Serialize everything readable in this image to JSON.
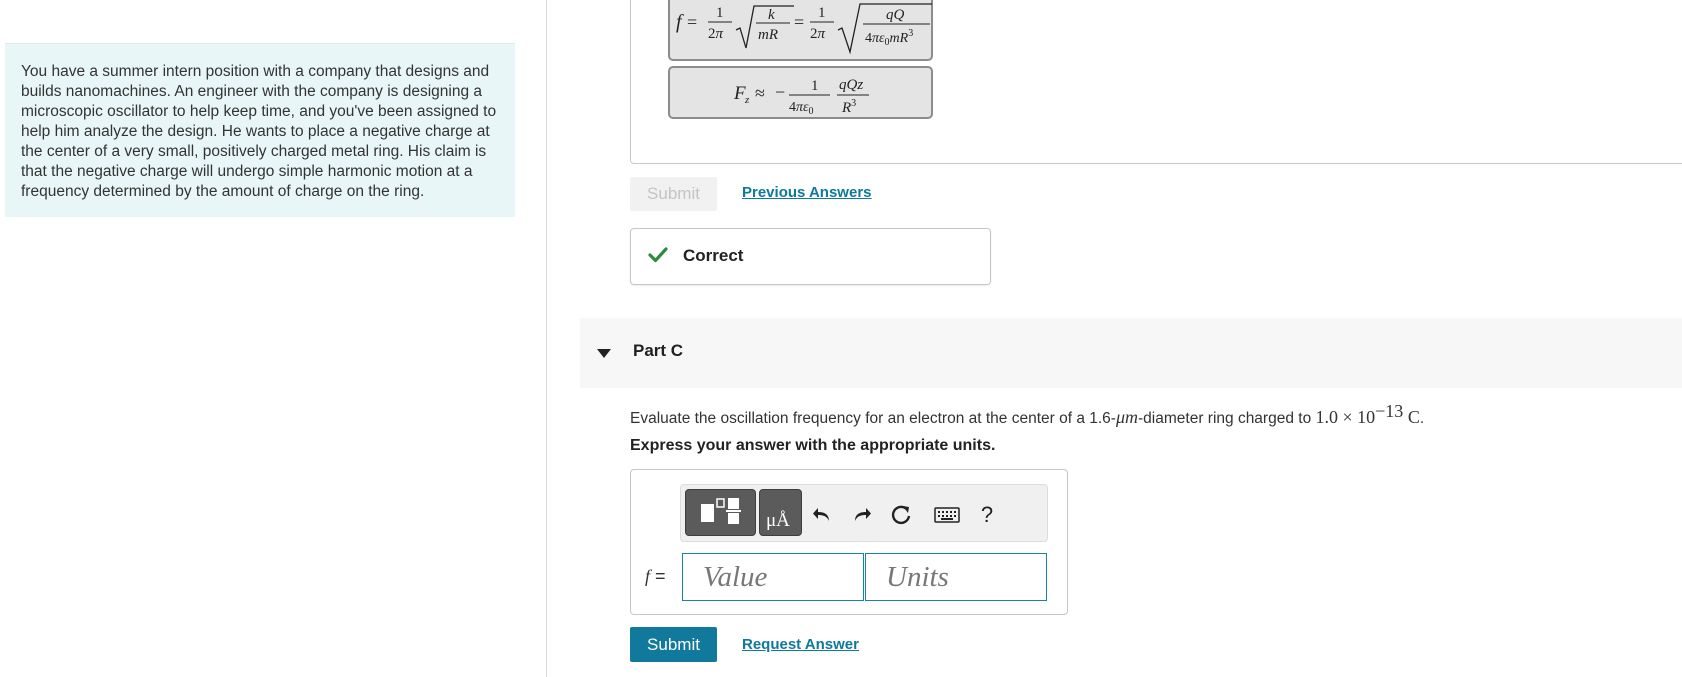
{
  "intro": {
    "text": "You have a summer intern position with a company that designs and builds nanomachines. An engineer with the company is designing a microscopic oscillator to help keep time, and you've been assigned to help him analyze the design. He wants to place a negative charge at the center of a very small, positively charged metal ring. His claim is that the negative charge will undergo simple harmonic motion at a frequency determined by the amount of charge on the ring."
  },
  "previous_answer": {
    "eq1": "f = 1/2π √(k/mR) = 1/2π √(qQ/4πε0mR³)",
    "eq2": "Fz ≈ −1/4πε0 · qQz/R³",
    "submit_label": "Submit",
    "previous_answers_label": "Previous Answers",
    "feedback": "Correct"
  },
  "part_c": {
    "title": "Part C",
    "question_prefix": "Evaluate the oscillation frequency for an electron at the center of a 1.6-",
    "question_unit": "μm",
    "question_mid": "-diameter ring charged to ",
    "question_value": "1.0 × 10",
    "question_exp": "−13",
    "question_charge_unit": " C",
    "question_end": ".",
    "instruction": "Express your answer with the appropriate units.",
    "answer_label_var": "f",
    "answer_label_eq": " =",
    "value_placeholder": "Value",
    "units_placeholder": "Units",
    "submit_label": "Submit",
    "request_answer_label": "Request Answer",
    "toolbar": {
      "templates_icon": "templates-icon",
      "units_icon": "units-icon",
      "units_glyph": "μÅ",
      "undo_icon": "undo-icon",
      "redo_icon": "redo-icon",
      "reset_icon": "reset-icon",
      "keyboard_icon": "keyboard-icon",
      "help_glyph": "?"
    }
  },
  "colors": {
    "intro_bg": "#e8f6f7",
    "accent": "#117a9c",
    "link": "#0d7a9c",
    "correct_check": "#2e8b3a",
    "equation_box": "#e4e4e4"
  }
}
